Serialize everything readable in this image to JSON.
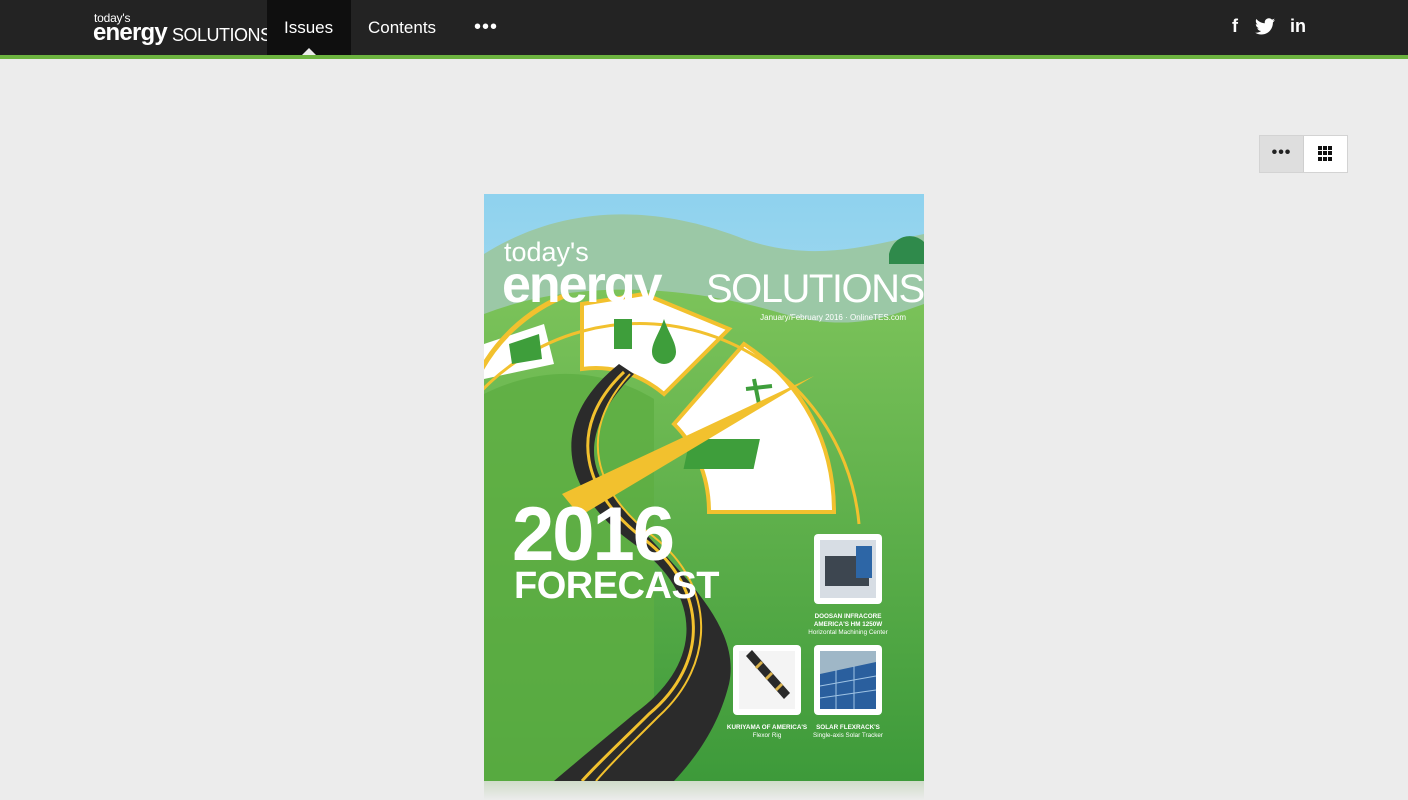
{
  "brand": {
    "todays": "today's",
    "energy": "energy",
    "solutions": "SOLUTIONS"
  },
  "nav": {
    "issues": "Issues",
    "contents": "Contents",
    "more": "•••"
  },
  "social": {
    "facebook": "f",
    "twitter": "🐦",
    "linkedin": "in"
  },
  "view_toggle": {
    "list": "•••",
    "grid_icon": "grid-icon"
  },
  "cover": {
    "masthead_todays": "today's",
    "masthead_energy": "energy",
    "masthead_solutions": "SOLUTIONS",
    "dateline": "January/February 2016 · OnlineTES.com",
    "headline_year": "2016",
    "headline_word": "FORECAST",
    "caption_doosan_1": "DOOSAN INFRACORE",
    "caption_doosan_2": "AMERICA'S HM 1250W",
    "caption_doosan_3": "Horizontal Machining Center",
    "caption_kuriyama_1": "KURIYAMA OF AMERICA'S",
    "caption_kuriyama_2": "Flexor Rig",
    "caption_solar_1": "SOLAR FLEXRACK'S",
    "caption_solar_2": "Single-axis Solar Tracker"
  },
  "colors": {
    "topbar": "#232323",
    "active_tab": "#0f0f0f",
    "accent_green": "#6cb33f",
    "page_bg": "#ececec",
    "cover_green": "#4aa23f",
    "cover_yellow": "#f2c12e"
  }
}
